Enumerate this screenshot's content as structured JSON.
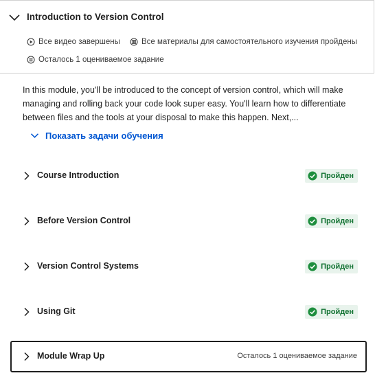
{
  "module": {
    "title": "Introduction to Version Control",
    "status": {
      "videos": "Все видео завершены",
      "materials": "Все материалы для самостоятельного изучения пройдены",
      "graded": "Осталось 1 оцениваемое задание"
    },
    "description": "In this module, you'll be introduced to the concept of version control, which will make managing and rolling back your code look super easy. You'll learn how to differentiate between files and the tools at your disposal to make this happen. Next,...",
    "show_tasks_label": "Показать задачи обучения"
  },
  "lessons": [
    {
      "title": "Course Introduction",
      "status": "Пройден"
    },
    {
      "title": "Before Version Control",
      "status": "Пройден"
    },
    {
      "title": "Version Control Systems",
      "status": "Пройден"
    },
    {
      "title": "Using Git",
      "status": "Пройден"
    },
    {
      "title": "Module Wrap Up",
      "status": "Осталось 1 оцениваемое задание"
    }
  ],
  "colors": {
    "link": "#0056d2",
    "success_text": "#137333",
    "success_bg": "#e8f3ec",
    "success_icon": "#1e8e3e"
  },
  "icons": {
    "header_toggle": "chevron-down-icon",
    "videos": "play-circle-icon",
    "materials": "book-circle-icon",
    "graded": "graded-list-icon",
    "show_tasks": "chevron-down-icon",
    "lesson_toggle": "chevron-right-icon",
    "completed": "check-circle-icon"
  }
}
